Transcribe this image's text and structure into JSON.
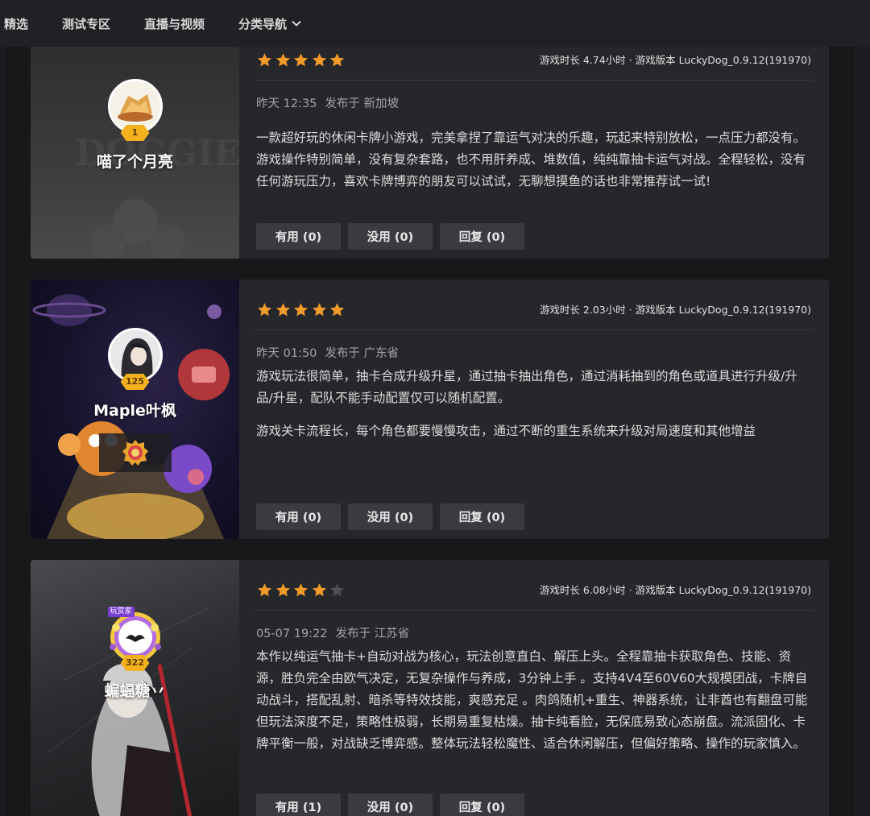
{
  "nav": {
    "items": [
      "精选",
      "测试专区",
      "直播与视频",
      "分类导航"
    ]
  },
  "colors": {
    "star_on": "#f39b2a",
    "star_off": "#4e4f54"
  },
  "reviews": [
    {
      "user": "喵了个月亮",
      "level": "1",
      "rating": 5,
      "meta": "游戏时长 4.74小时 · 游戏版本 LuckyDog_0.9.12(191970)",
      "time": "昨天 12:35",
      "location": "发布于 新加坡",
      "paragraphs": [
        "一款超好玩的休闲卡牌小游戏，完美拿捏了靠运气对决的乐趣，玩起来特别放松，一点压力都没有。游戏操作特别简单，没有复杂套路，也不用肝养成、堆数值，纯纯靠抽卡运气对战。全程轻松，没有任何游玩压力，喜欢卡牌博弈的朋友可以试试，无聊想摸鱼的话也非常推荐试一试!"
      ],
      "btn_useful": "有用 (0)",
      "btn_useless": "没用 (0)",
      "btn_reply": "回复 (0)"
    },
    {
      "user": "Maple叶枫",
      "level": "125",
      "rating": 5,
      "meta": "游戏时长 2.03小时 · 游戏版本 LuckyDog_0.9.12(191970)",
      "time": "昨天 01:50",
      "location": "发布于 广东省",
      "paragraphs": [
        "游戏玩法很简单，抽卡合成升级升星，通过抽卡抽出角色，通过消耗抽到的角色或道具进行升级/升品/升星，配队不能手动配置仅可以随机配置。",
        "游戏关卡流程长，每个角色都要慢慢攻击，通过不断的重生系统来升级对局速度和其他增益"
      ],
      "btn_useful": "有用 (0)",
      "btn_useless": "没用 (0)",
      "btn_reply": "回复 (0)"
    },
    {
      "user": "蝙蝠糖丷",
      "level": "322",
      "badge": "玩赏家",
      "rating": 4,
      "meta": "游戏时长 6.08小时 · 游戏版本 LuckyDog_0.9.12(191970)",
      "time": "05-07 19:22",
      "location": "发布于 江苏省",
      "paragraphs": [
        "本作以纯运气抽卡+自动对战为核心，玩法创意直白、解压上头。全程靠抽卡获取角色、技能、资源，胜负完全由欧气决定，无复杂操作与养成，3分钟上手 。支持4V4至60V60大规模团战，卡牌自动战斗，搭配乱射、暗杀等特效技能，爽感充足 。肉鸽随机+重生、神器系统，让非酋也有翻盘可能 但玩法深度不足，策略性极弱，长期易重复枯燥。抽卡纯看脸，无保底易致心态崩盘。流派固化、卡牌平衡一般，对战缺乏博弈感。整体玩法轻松魔性、适合休闲解压，但偏好策略、操作的玩家慎入。"
      ],
      "btn_useful": "有用 (1)",
      "btn_useless": "没用 (0)",
      "btn_reply": "回复 (0)"
    }
  ]
}
